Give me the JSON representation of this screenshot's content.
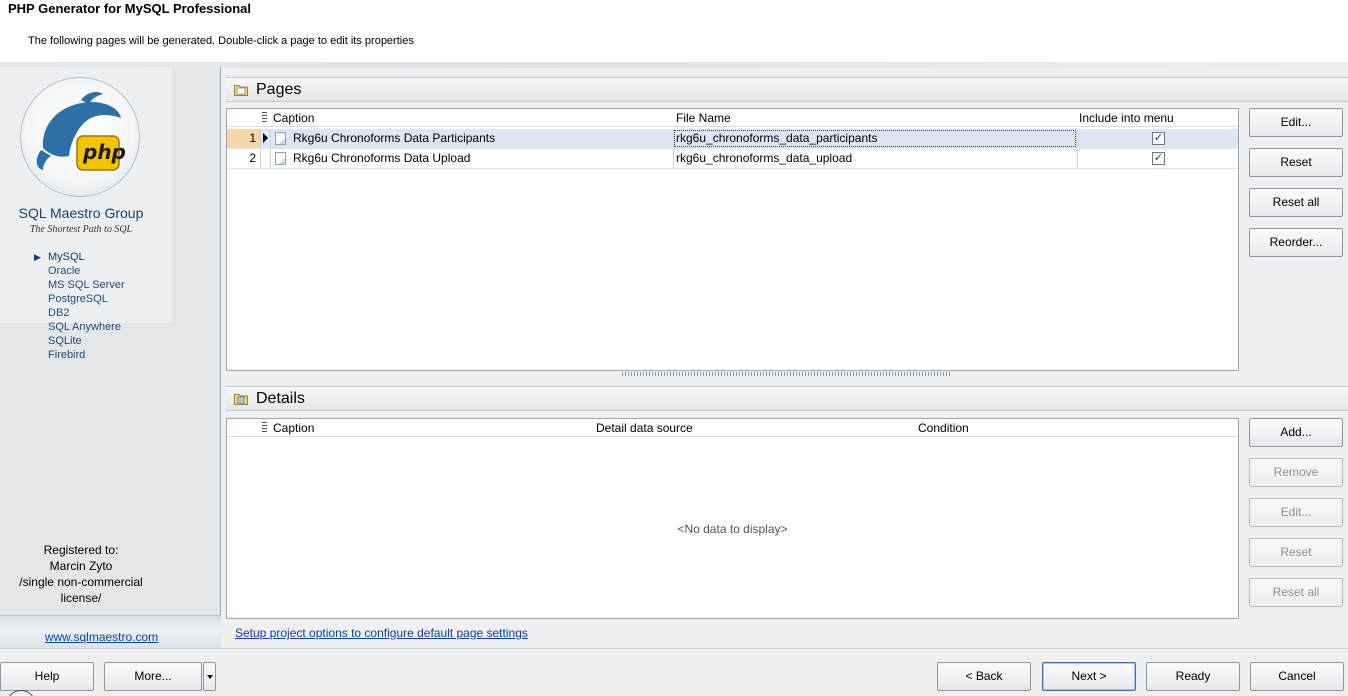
{
  "header": {
    "title": "PHP Generator for MySQL Professional",
    "subtitle": "The following pages will be generated. Double-click a page to edit its properties"
  },
  "sidebar": {
    "logo_text": "php",
    "brand": "SQL Maestro Group",
    "tagline": "The Shortest Path to SQL",
    "databases": [
      "MySQL",
      "Oracle",
      "MS SQL Server",
      "PostgreSQL",
      "DB2",
      "SQL Anywhere",
      "SQLite",
      "Firebird"
    ],
    "active_database": "MySQL",
    "registered": {
      "line1": "Registered to:",
      "line2": "Marcin Zyto",
      "line3": "/single non-commercial",
      "line4": "license/"
    },
    "website": "www.sqlmaestro.com"
  },
  "pages_section": {
    "title": "Pages",
    "columns": {
      "caption": "Caption",
      "file_name": "File Name",
      "include": "Include into menu"
    },
    "rows": [
      {
        "num": "1",
        "caption": "Rkg6u Chronoforms Data Participants",
        "file_name": "rkg6u_chronoforms_data_participants",
        "include": true,
        "selected": true
      },
      {
        "num": "2",
        "caption": "Rkg6u Chronoforms Data Upload",
        "file_name": "rkg6u_chronoforms_data_upload",
        "include": true,
        "selected": false
      }
    ],
    "buttons": {
      "edit": "Edit...",
      "reset": "Reset",
      "reset_all": "Reset all",
      "reorder": "Reorder..."
    }
  },
  "details_section": {
    "title": "Details",
    "columns": {
      "caption": "Caption",
      "detail_source": "Detail data source",
      "condition": "Condition"
    },
    "empty_message": "<No data to display>",
    "buttons": {
      "add": "Add...",
      "remove": "Remove",
      "edit": "Edit...",
      "reset": "Reset",
      "reset_all": "Reset all"
    }
  },
  "setup_link": "Setup project options to configure default page settings",
  "footer": {
    "help": "Help",
    "more": "More...",
    "back": "< Back",
    "next": "Next >",
    "ready": "Ready",
    "cancel": "Cancel"
  },
  "checkmark": "✓"
}
